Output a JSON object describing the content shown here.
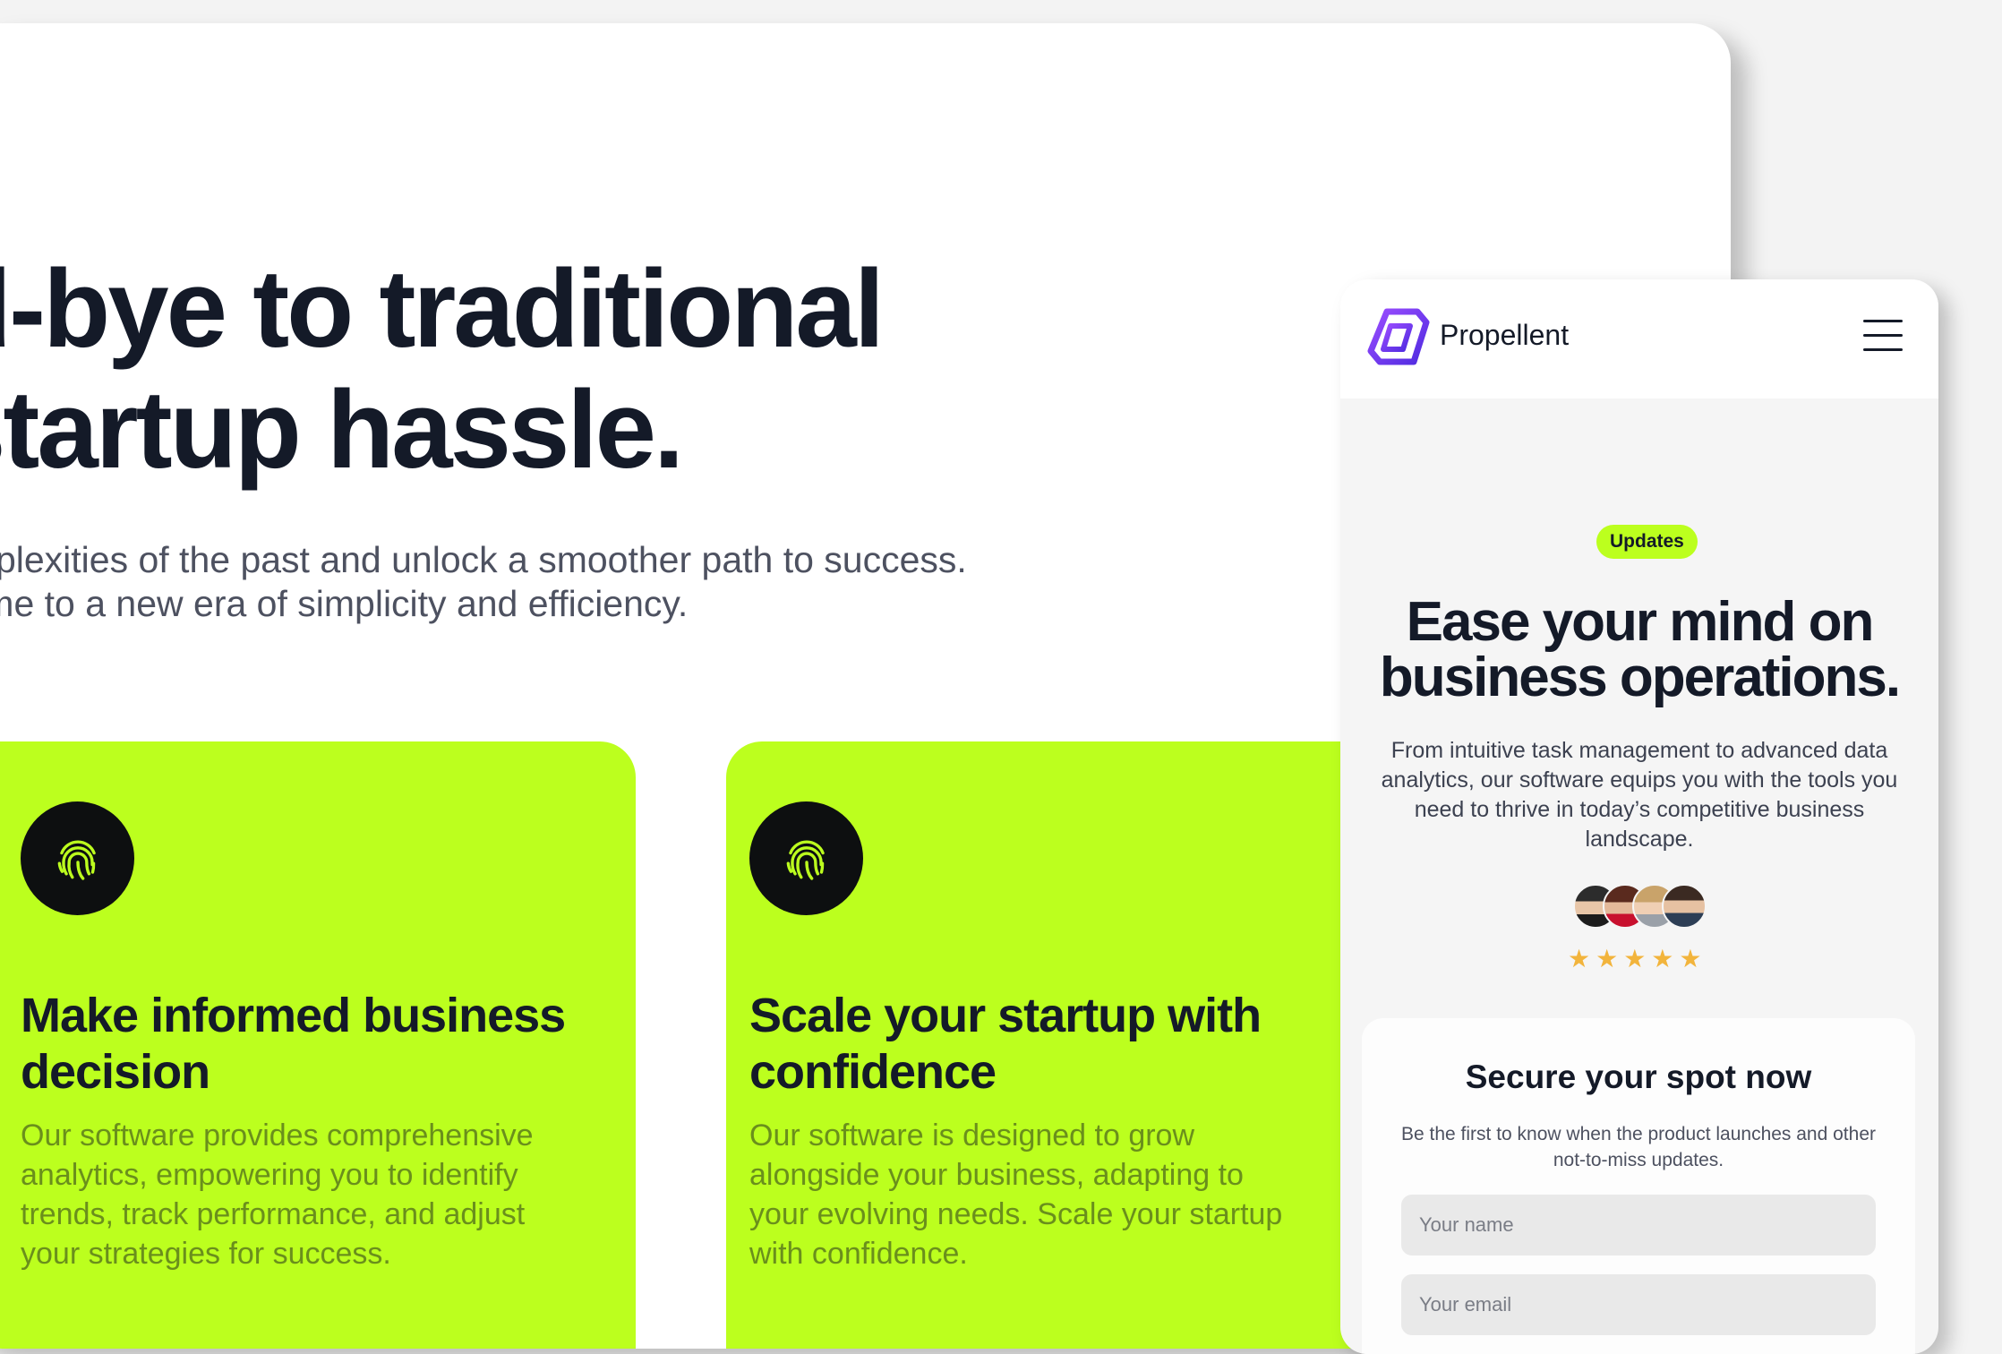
{
  "desktop": {
    "hero_title_line1": "d-bye to traditional",
    "hero_title_line2": "startup hassle.",
    "hero_sub_line1": "omplexities of the past and unlock a smoother path to success.",
    "hero_sub_line2": "come to a new era of simplicity and efficiency.",
    "cards": [
      {
        "icon": "fingerprint-icon",
        "title": "Make informed business decision",
        "body": "Our software provides comprehensive analytics, empowering you to identify trends, track performance, and adjust your strategies for success."
      },
      {
        "icon": "fingerprint-icon",
        "title": "Scale your startup with confidence",
        "body": "Our software is designed to grow alongside your business, adapting to your evolving needs. Scale your startup with confidence."
      }
    ]
  },
  "mobile": {
    "brand": "Propellent",
    "logo_icon": "propellent-logo-icon",
    "menu_icon": "hamburger-menu-icon",
    "badge": "Updates",
    "title_line1": "Ease your mind on",
    "title_line2": "business operations.",
    "subtitle": "From intuitive task management to advanced data analytics, our software equips you with the tools you need to thrive in today’s competitive business landscape.",
    "stars": "★★★★★",
    "rating": 5,
    "form": {
      "title": "Secure your spot now",
      "subtitle": "Be the first to know when the product launches and other not-to-miss updates.",
      "name_placeholder": "Your name",
      "email_placeholder": "Your email"
    }
  },
  "colors": {
    "accent": "#bcff1e",
    "text_dark": "#141a28",
    "logo_purple": "#7b3ff2",
    "star": "#f2b43c"
  }
}
